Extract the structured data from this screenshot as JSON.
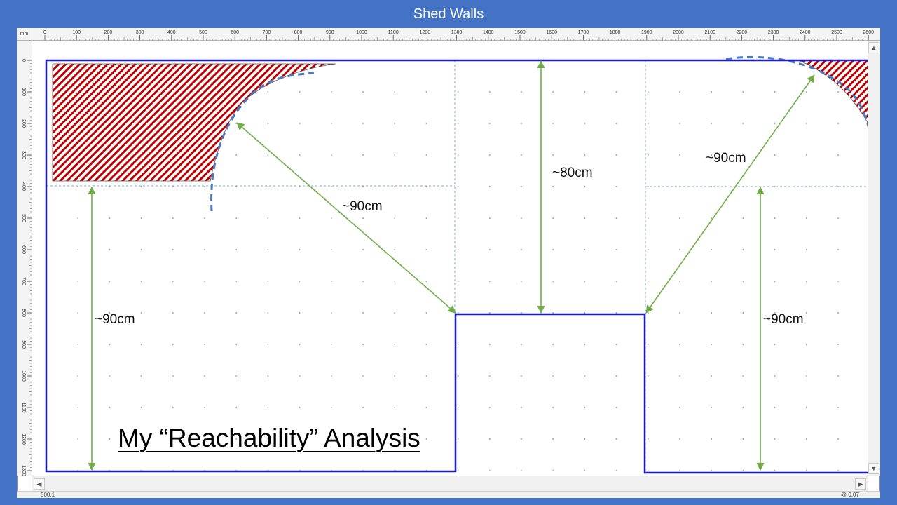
{
  "window": {
    "title": "Shed Walls"
  },
  "ruler": {
    "unit": "mm",
    "horizontal_ticks": [
      "0",
      "100",
      "200",
      "300",
      "400",
      "500",
      "600",
      "700",
      "800",
      "900",
      "1000",
      "1100",
      "1200",
      "1300",
      "1400",
      "1500",
      "1600",
      "1700",
      "1800",
      "1900",
      "2000",
      "2100",
      "2200",
      "2300",
      "2400",
      "2500",
      "2600"
    ],
    "vertical_ticks": [
      "0",
      "100",
      "200",
      "300",
      "400",
      "500",
      "600",
      "700",
      "800",
      "900",
      "1000",
      "1100",
      "1200",
      "1300"
    ]
  },
  "drawing": {
    "title": "My “Reachability” Analysis",
    "dimensions": {
      "left_vertical": "~90cm",
      "diagonal_left": "~90cm",
      "center_vertical": "~80cm",
      "diagonal_right": "~90cm",
      "right_vertical": "~90cm"
    },
    "colors": {
      "outline": "#1A1AD0",
      "reach_arc": "#4A79C0",
      "arrow": "#70AD47",
      "hatch": "#C00000",
      "guide": "#7FA7D9",
      "grid_dot": "#8a8a8a"
    }
  },
  "status": {
    "left": "500,1",
    "right": "@ 0.07"
  }
}
